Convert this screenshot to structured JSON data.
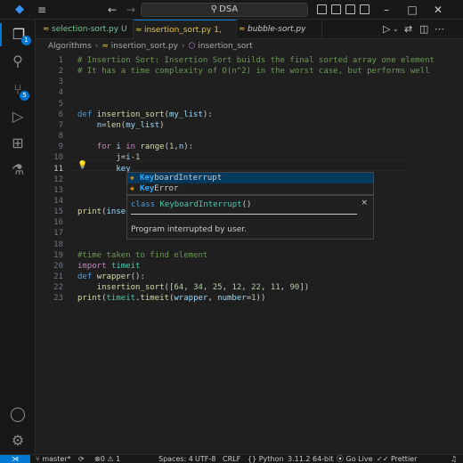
{
  "titlebar": {
    "search_text": "DSA",
    "search_icon": "search-icon",
    "logo": "vscode-logo"
  },
  "activity": {
    "explorer_badge": "1",
    "scm_badge": "5"
  },
  "tabs": [
    {
      "label": "selection-sort.py",
      "flag": "U",
      "color": "#73c991",
      "italic": false,
      "active": false
    },
    {
      "label": "insertion_sort.py",
      "flag": "1, U",
      "color": "#e8c33c",
      "italic": false,
      "active": true
    },
    {
      "label": "bubble-sort.py",
      "flag": "",
      "color": "#cccccc",
      "italic": true,
      "active": false
    }
  ],
  "breadcrumb": {
    "folder": "Algorithms",
    "file": "insertion_sort.py",
    "symbol": "insertion_sort"
  },
  "editor": {
    "line_numbers": [
      "1",
      "2",
      "3",
      "4",
      "5",
      "6",
      "7",
      "8",
      "9",
      "10",
      "11",
      "12",
      "13",
      "14",
      "15",
      "16",
      "17",
      "18",
      "19",
      "20",
      "21",
      "22",
      "23"
    ],
    "current_line": "11",
    "lines": [
      "# Insertion Sort: Insertion Sort builds the final sorted array one element",
      "# It has a time complexity of O(n^2) in the worst case, but performs well",
      "",
      "",
      "",
      "def insertion_sort(my_list):",
      "    n=len(my_list)",
      "",
      "    for i in range(1,n):",
      "        j=i-1",
      "        key",
      "",
      "",
      "",
      "print(inser",
      "",
      "",
      "",
      "#time taken to find element",
      "import timeit",
      "def wrapper():",
      "    insertion_sort([64, 34, 25, 12, 22, 11, 90])",
      "print(timeit.timeit(wrapper, number=1))"
    ]
  },
  "suggest": {
    "items": [
      {
        "match": "Key",
        "rest": "boardInterrupt",
        "icon": "class-icon"
      },
      {
        "match": "Key",
        "rest": "Error",
        "icon": "class-icon"
      }
    ],
    "detail_kw": "class",
    "detail_name": "KeyboardInterrupt",
    "detail_tail": "()",
    "detail_doc": "Program interrupted by user.",
    "close": "×"
  },
  "status": {
    "branch": "master*",
    "problems": "0",
    "warnings": "1",
    "spaces": "Spaces: 4",
    "encoding": "UTF-8",
    "eol": "CRLF",
    "language": "Python",
    "interpreter": "3.11.2 64-bit",
    "golive": "Go Live",
    "prettier": "Prettier"
  }
}
